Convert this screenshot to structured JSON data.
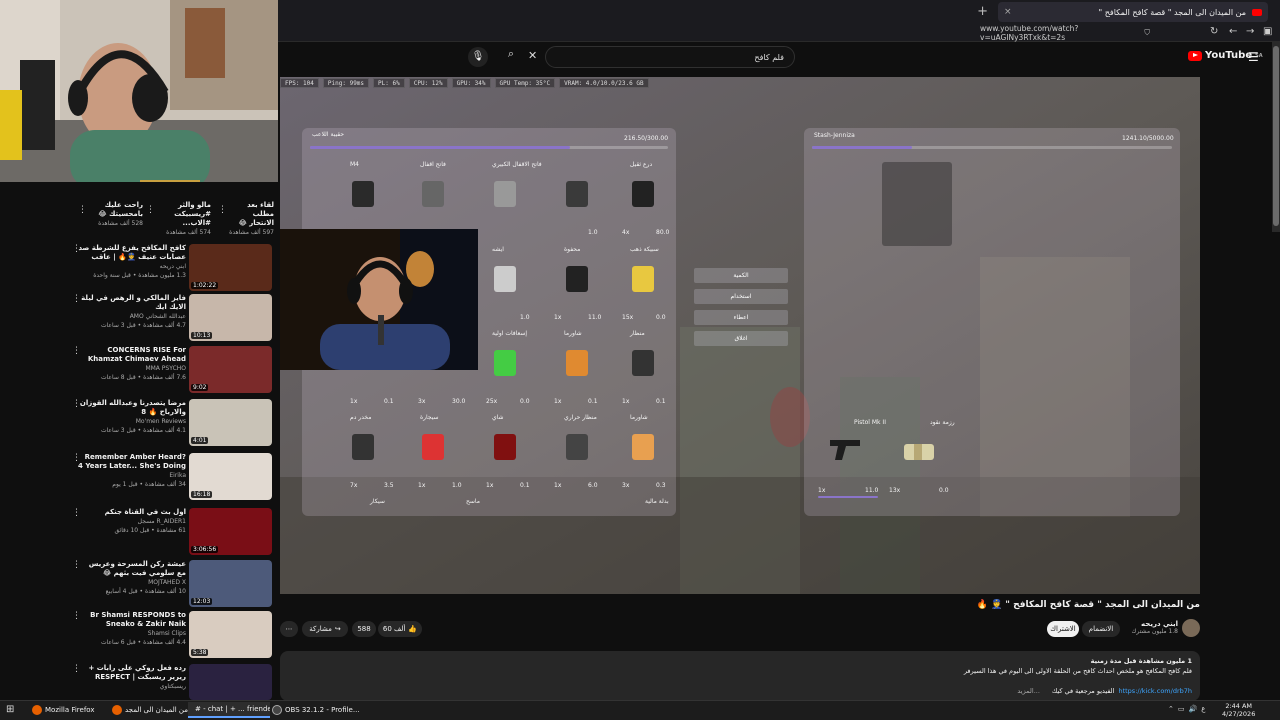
{
  "browser": {
    "tab_title": "من الميدان الى المجد \" قصة كافح المكافح \"",
    "url": "www.youtube.com/watch?v=uAGINy3RTxk&t=2s",
    "new_tab": "+",
    "close": "×"
  },
  "youtube": {
    "logo_text": "YouTube",
    "logo_region": "SA",
    "search_value": "فلم كافح"
  },
  "overlay_stats": [
    "FPS: 104",
    "Ping: 99ms",
    "PL: 6%",
    "CPU: 12%",
    "GPU: 34%",
    "GPU Temp: 35°C",
    "VRAM: 4.0/10.0/23.6 GB"
  ],
  "game": {
    "left_panel_title": "حقيبة اللاعب",
    "left_panel_weight": "216.50/300.00",
    "right_panel_title": "Stash-Jenniza",
    "right_panel_weight": "1241.10/5000.00",
    "menu_buttons": [
      "الكمية",
      "استخدام",
      "اعطاء",
      "اغلاق"
    ],
    "left_rows": [
      {
        "labels": [
          "درع ثقيل",
          "",
          "فاتح الاقفال الكبيري",
          "فاتح اقفال",
          "M4"
        ],
        "nums": [
          "80.0",
          "4x",
          "1.0",
          "",
          ""
        ]
      },
      {
        "labels": [
          "سبيكة ذهب",
          "محفوة",
          "ايشه",
          "",
          ""
        ],
        "nums": [
          "0.0",
          "15x",
          "11.0",
          "1x",
          "1.0"
        ]
      },
      {
        "labels": [
          "منظار",
          "شاورما",
          "إسعافات اولية",
          "",
          ""
        ],
        "nums": [
          "0.1",
          "1x",
          "0.1",
          "1x",
          "0.0",
          "25x",
          "30.0",
          "3x",
          "0.1",
          "1x"
        ]
      },
      {
        "labels": [
          "شاورما",
          "منظار حراري",
          "شاي",
          "سيجارة",
          "مخدر دم"
        ],
        "nums": [
          "0.3",
          "3x",
          "6.0",
          "1x",
          "0.1",
          "1x",
          "1.0",
          "1x",
          "3.5",
          "7x"
        ]
      }
    ],
    "bottom_labels": [
      "بدلة مالية",
      "ماسح",
      "سيكار"
    ],
    "right_items": [
      {
        "label": "Pistol Mk II",
        "count": "1x",
        "weight": "11.0"
      },
      {
        "label": "رزمة نقود",
        "count": "13x",
        "weight": "0.0"
      }
    ]
  },
  "video": {
    "title": "من الميدان الى المجد \" قصة كافح المكافح \" 👮 🔥",
    "channel": "ابني دريحه",
    "subscribers": "1.8 مليون مشترك",
    "join_label": "الانضمام",
    "subscribe_label": "الاشتراك",
    "likes": "60 ألف",
    "comments": "588",
    "share_label": "مشاركة",
    "more": "...",
    "desc_meta": "1 مليون مشاهدة قبل مدة زمنية",
    "desc_line1": "فلم كافح المكافح هو ملخص احداث كافح من الحلقة الاولى الى اليوم في هذا السيرفر",
    "desc_link": "https://kick.com/drb7h",
    "desc_line2": "الفيديو مرجعية في كيك",
    "desc_more": "...المزيد"
  },
  "sidebar": {
    "top_row": [
      {
        "title": "لقاء بعد مطلب الانتحار 😂",
        "views": "597 ألف مشاهدة"
      },
      {
        "title": "مالو والثر #ريسبيكت #الاب...",
        "views": "574 ألف مشاهدة"
      },
      {
        "title": "راحت عليك بامحسيتك 😂",
        "views": "528 ألف مشاهدة"
      }
    ],
    "items": [
      {
        "title": "كافح المكافح يفزع للشرطة صد عصابات عنيف 👮🔥 | عاقب ينهم كافح بالإجرام...",
        "channel": "ابني دريحه",
        "meta": "1.3 مليون مشاهدة • قبل سنة واحدة",
        "duration": "1:02:22"
      },
      {
        "title": "فايز المالكي و الرهص في ليلة الايك ايك",
        "channel": "عبدالله الشحاني AMO",
        "meta": "4.7 ألف مشاهدة • قبل 3 ساعات",
        "duration": "10:13"
      },
      {
        "title": "CONCERNS RISE For Khamzat Chimaev Ahead of UFC 328...",
        "channel": "MMA PSYCHO",
        "meta": "7.6 ألف مشاهدة • قبل 8 ساعات",
        "duration": "9:02"
      },
      {
        "title": "مرضا يتصدرنا وعبدالله القوزان والارباح 🔥 8",
        "channel": "Mo'men Reviews",
        "meta": "4.1 ألف مشاهدة • قبل 3 ساعات",
        "duration": "4:01"
      },
      {
        "title": "Remember Amber Heard? 4 Years Later... She's Doing Worse",
        "channel": "Eirika",
        "meta": "34 ألف مشاهدة • قبل 1 يوم",
        "duration": "16:18"
      },
      {
        "title": "اول بث في القناة جنكم",
        "channel": "R_AIDER1 مسجل",
        "meta": "61 مشاهدة • قبل 10 دقائق",
        "duration": "3:06:56"
      },
      {
        "title": "عيشة ركن المسرحة وعريس مع سلومي فيت بثهم 😂",
        "channel": "MOJTAHED X",
        "meta": "10 ألف مشاهدة • قبل 4 أسابيع",
        "duration": "12:03"
      },
      {
        "title": "Br Shamsi RESPONDS to Sneako & Zakir Naik",
        "channel": "Shamsi Clips",
        "meta": "4.4 ألف مشاهدة • قبل 6 ساعات",
        "duration": "5:38"
      },
      {
        "title": "رده فعل روكي على رابات + ريرير ريسبكت | RESPECT",
        "channel": "ريسبكتاوي",
        "meta": "",
        "duration": ""
      }
    ]
  },
  "taskbar": {
    "items": [
      "Mozilla Firefox",
      "من الميدان الى المجد",
      "# - chat | + ... friende...",
      "OBS 32.1.2 - Profile..."
    ],
    "time": "2:44 AM",
    "date": "4/27/2026",
    "lang": "ع"
  },
  "colors": {
    "yt_red": "#ff0000",
    "panel_bar": "#8a74c9",
    "bg": "#0f0f0f"
  }
}
